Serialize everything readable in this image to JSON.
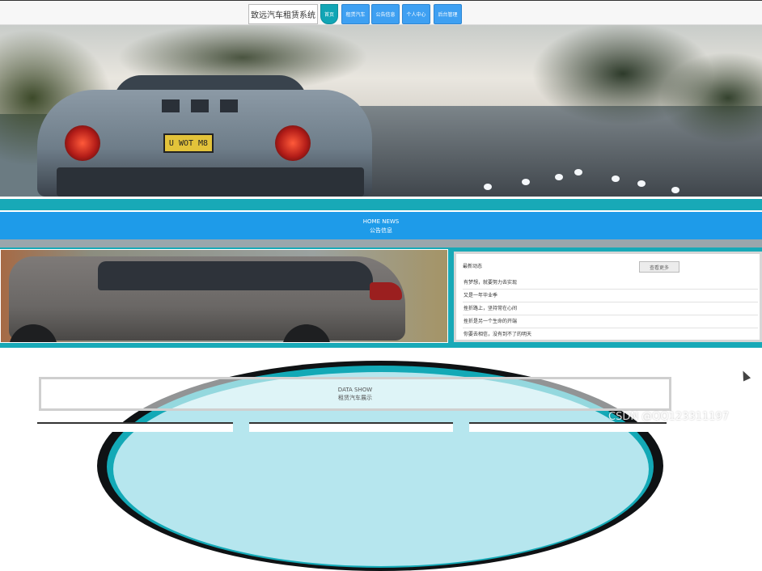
{
  "header": {
    "brand": "致远汽车租赁系统",
    "nav": [
      {
        "label": "首页",
        "active": true
      },
      {
        "label": "租赁汽车",
        "active": false
      },
      {
        "label": "公告信息",
        "active": false
      },
      {
        "label": "个人中心",
        "active": false
      },
      {
        "label": "后台管理",
        "active": false
      }
    ]
  },
  "hero": {
    "plate_text": "U WOT M8"
  },
  "news_section": {
    "title_en": "HOME NEWS",
    "title_cn": "公告信息",
    "panel_heading": "最新动态",
    "more_button": "查看更多",
    "items": [
      "有梦想，就要努力去实现",
      "又是一年毕业季",
      "挫折路上，坚持常在心间",
      "挫折是另一个生命的开端",
      "你要去相信，没有到不了的明天"
    ]
  },
  "data_show": {
    "title_en": "DATA SHOW",
    "title_cn": "租赁汽车展示"
  },
  "watermark": "CSDN @QQ123311197",
  "colors": {
    "teal": "#18a9b7",
    "blue": "#1e9be9",
    "nav_blue": "#3ea0f2"
  }
}
